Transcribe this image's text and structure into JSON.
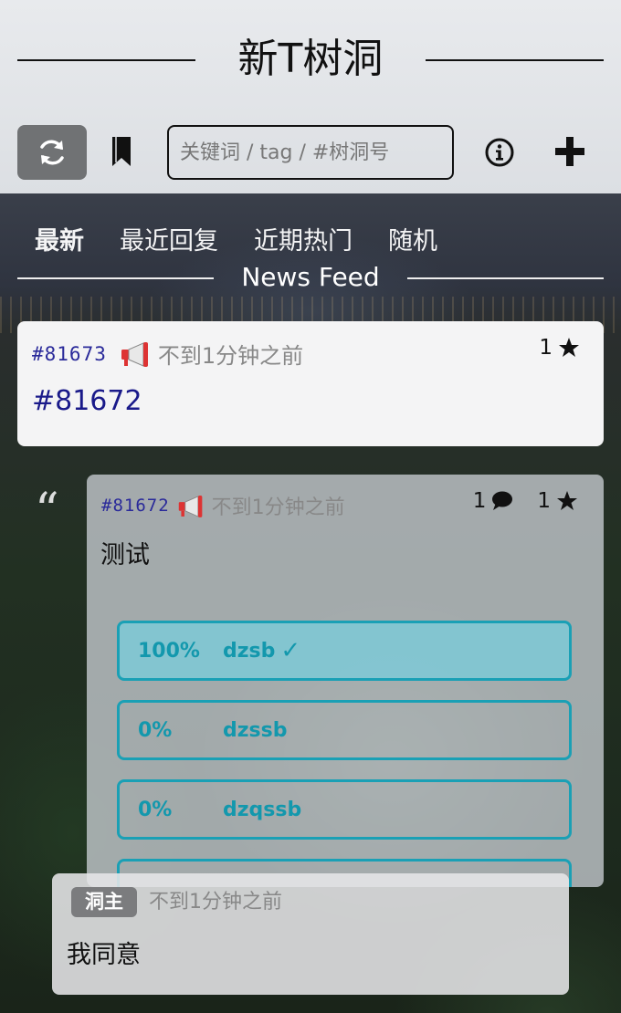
{
  "app": {
    "title": "新T树洞"
  },
  "toolbar": {
    "search_placeholder": "关键词 / tag / #树洞号",
    "icons": [
      "refresh-icon",
      "bookmark-icon",
      "info-icon",
      "plus-icon"
    ]
  },
  "tabs": [
    {
      "label": "最新",
      "active": true
    },
    {
      "label": "最近回复",
      "active": false
    },
    {
      "label": "近期热门",
      "active": false
    },
    {
      "label": "随机",
      "active": false
    }
  ],
  "feed_label": "News Feed",
  "posts": [
    {
      "id": "#81673",
      "time": "不到1分钟之前",
      "stars": "1",
      "body": "#81672"
    },
    {
      "id": "#81672",
      "time": "不到1分钟之前",
      "comments": "1",
      "stars": "1",
      "body": "测试",
      "poll": [
        {
          "percent": "100%",
          "option": "dzsb",
          "check": "✓",
          "selected": true
        },
        {
          "percent": "0%",
          "option": "dzssb",
          "selected": false
        },
        {
          "percent": "0%",
          "option": "dzqssb",
          "selected": false
        }
      ]
    }
  ],
  "reply": {
    "badge": "洞主",
    "time": "不到1分钟之前",
    "body": "我同意"
  },
  "colors": {
    "accent": "#1aa0b5",
    "post_id": "#2a2a9a",
    "header_bg": "#e3e5e8"
  }
}
